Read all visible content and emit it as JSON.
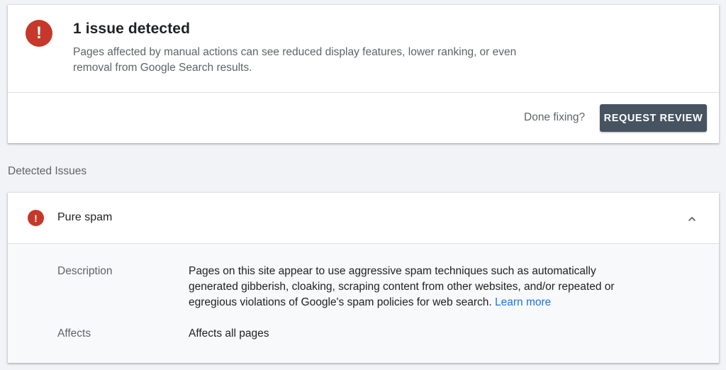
{
  "summary": {
    "icon": "error-icon",
    "title": "1 issue detected",
    "description": "Pages affected by manual actions can see reduced display features, lower ranking, or even removal from Google Search results.",
    "done_fixing_label": "Done fixing?",
    "request_review_label": "REQUEST REVIEW"
  },
  "section_heading": "Detected Issues",
  "issue": {
    "icon": "error-icon",
    "title": "Pure spam",
    "toggle_icon": "chevron-up-icon",
    "description_label": "Description",
    "description_text": "Pages on this site appear to use aggressive spam techniques such as automatically generated gibberish, cloaking, scraping content from other websites, and/or repeated or egregious violations of Google's spam policies for web search.",
    "learn_more_label": "Learn more",
    "affects_label": "Affects",
    "affects_value": "Affects all pages"
  },
  "colors": {
    "error": "#c5382a",
    "button": "#465361",
    "link": "#1a73e8"
  }
}
